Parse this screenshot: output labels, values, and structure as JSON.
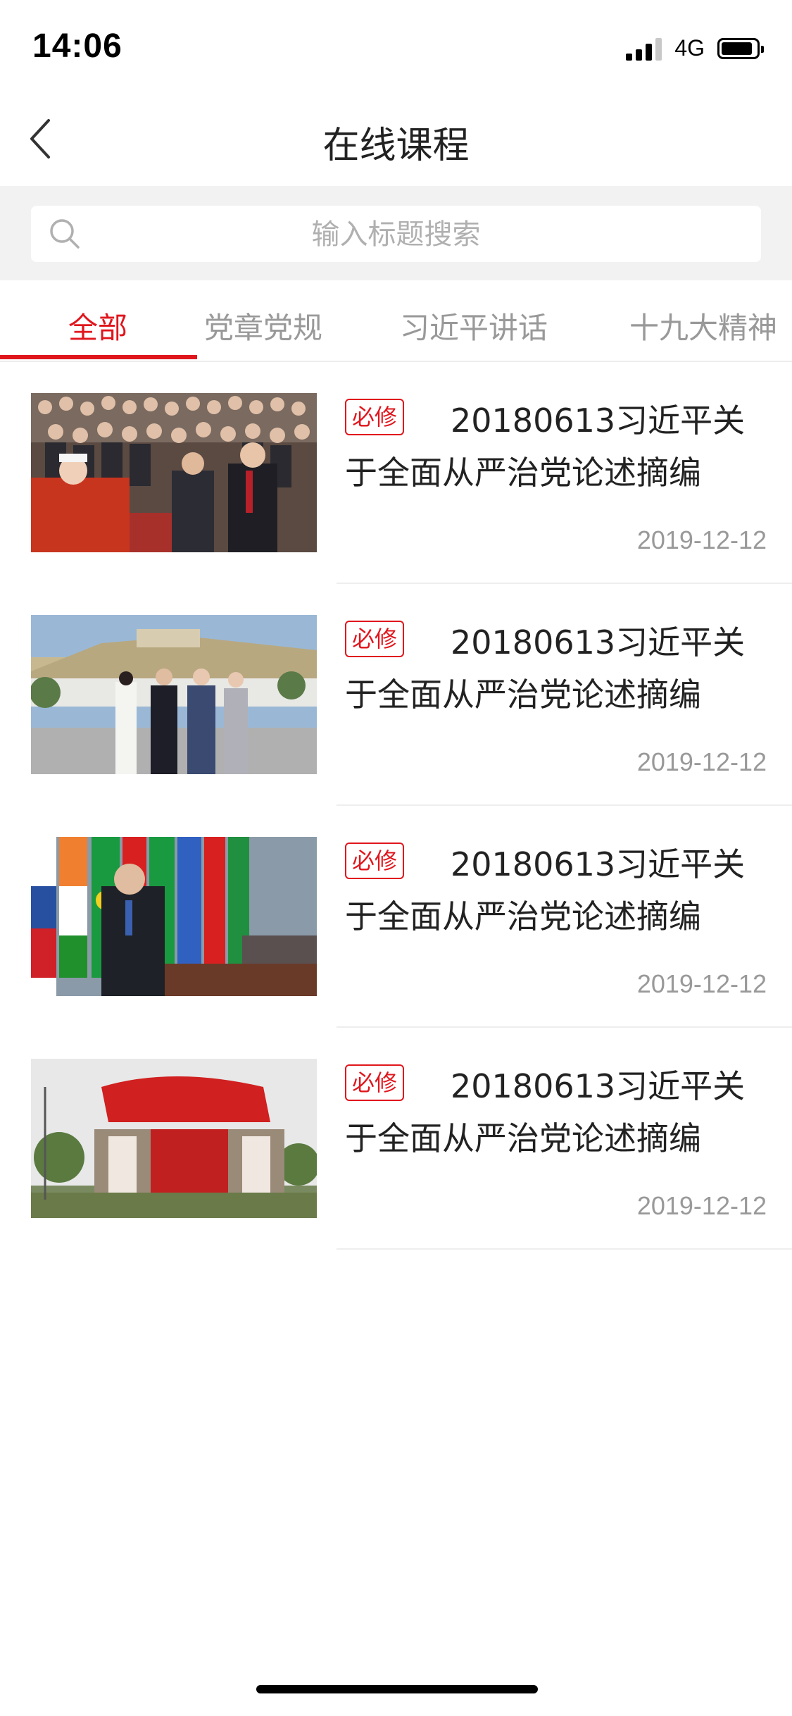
{
  "status_bar": {
    "time": "14:06",
    "network": "4G",
    "battery_level": 0.9
  },
  "nav": {
    "title": "在线课程",
    "back_icon": "chevron-left-icon"
  },
  "search": {
    "placeholder": "输入标题搜索",
    "icon": "search-icon"
  },
  "tabs": [
    {
      "label": "全部",
      "active": true
    },
    {
      "label": "党章党规",
      "active": false
    },
    {
      "label": "习近平讲话",
      "active": false
    },
    {
      "label": "十九大精神",
      "active": false
    }
  ],
  "colors": {
    "accent": "#e0161d",
    "muted": "#999999",
    "background_gray": "#f2f2f2"
  },
  "courses": [
    {
      "badge": "必修",
      "title": "20180613习近平关于全面从严治党论述摘编",
      "date": "2019-12-12",
      "thumbnail": "crowd-meeting-photo"
    },
    {
      "badge": "必修",
      "title": "20180613习近平关于全面从严治党论述摘编",
      "date": "2019-12-12",
      "thumbnail": "acropolis-visit-photo"
    },
    {
      "badge": "必修",
      "title": "20180613习近平关于全面从严治党论述摘编",
      "date": "2019-12-12",
      "thumbnail": "flags-speech-photo"
    },
    {
      "badge": "必修",
      "title": "20180613习近平关于全面从严治党论述摘编",
      "date": "2019-12-12",
      "thumbnail": "party-park-sign-photo"
    }
  ]
}
